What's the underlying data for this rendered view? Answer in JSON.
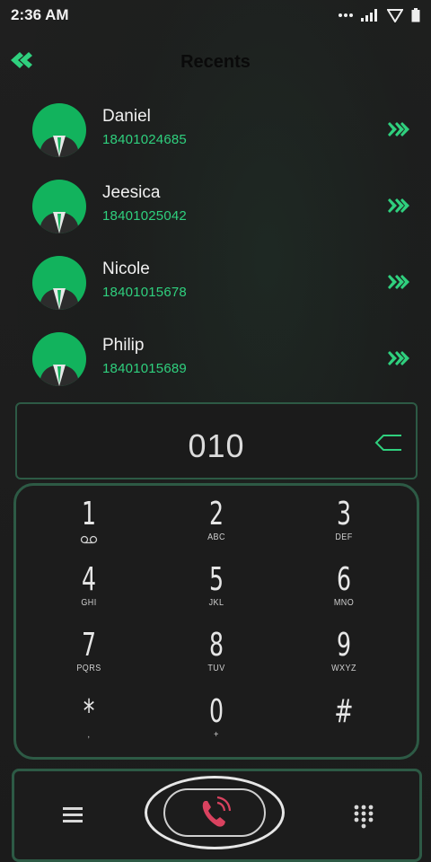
{
  "status_bar": {
    "time": "2:36 AM"
  },
  "header": {
    "title": "Recents"
  },
  "contacts": [
    {
      "name": "Daniel",
      "number": "18401024685"
    },
    {
      "name": "Jeesica",
      "number": "18401025042"
    },
    {
      "name": "Nicole",
      "number": "18401015678"
    },
    {
      "name": "Philip",
      "number": "18401015689"
    }
  ],
  "dialer": {
    "display_number": "010"
  },
  "keypad": [
    {
      "digit": "1",
      "letters": ""
    },
    {
      "digit": "2",
      "letters": "ABC"
    },
    {
      "digit": "3",
      "letters": "DEF"
    },
    {
      "digit": "4",
      "letters": "GHI"
    },
    {
      "digit": "5",
      "letters": "JKL"
    },
    {
      "digit": "6",
      "letters": "MNO"
    },
    {
      "digit": "7",
      "letters": "PQRS"
    },
    {
      "digit": "8",
      "letters": "TUV"
    },
    {
      "digit": "9",
      "letters": "WXYZ"
    },
    {
      "digit": "*",
      "letters": ","
    },
    {
      "digit": "0",
      "letters": "+"
    },
    {
      "digit": "#",
      "letters": ""
    }
  ],
  "colors": {
    "accent": "#2fd07e",
    "avatar_bg": "#12b35d",
    "border": "#2d5a45",
    "call_icon": "#d9425f"
  },
  "icons": {
    "back": "double-chevron-left-icon",
    "contact_action": "double-chevron-right-icon",
    "voicemail": "voicemail-icon",
    "backspace": "backspace-icon",
    "menu": "menu-icon",
    "call": "phone-call-icon",
    "dialpad": "dialpad-icon"
  }
}
